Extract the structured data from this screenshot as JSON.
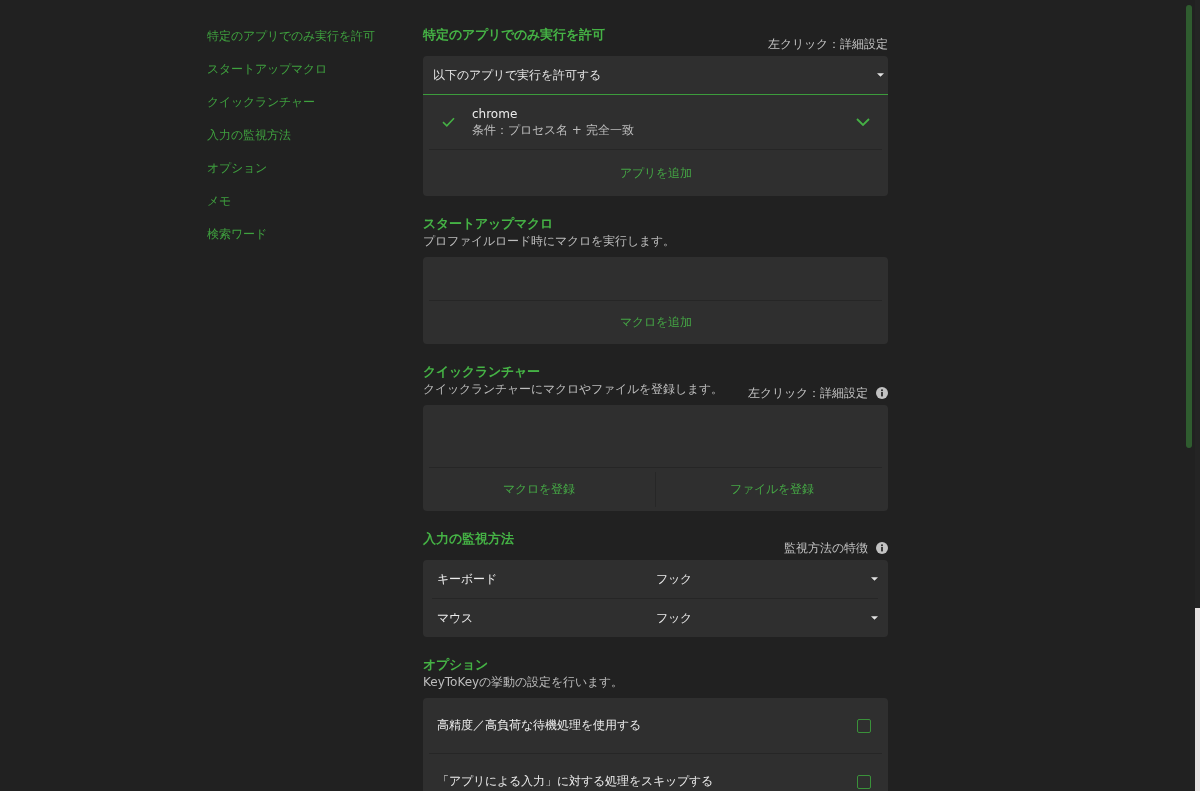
{
  "sidebar": {
    "items": [
      "特定のアプリでのみ実行を許可",
      "スタートアップマクロ",
      "クイックランチャー",
      "入力の監視方法",
      "オプション",
      "メモ",
      "検索ワード"
    ]
  },
  "sections": [
    {
      "kind": "app_filter",
      "title": "特定のアプリでのみ実行を許可",
      "hint": {
        "text": "左クリック：詳細設定"
      },
      "dropdown": {
        "value": "以下のアプリで実行を許可する"
      },
      "apps": [
        {
          "name": "chrome",
          "condition": "条件：プロセス名 + 完全一致",
          "enabled": true,
          "expanded": false
        }
      ],
      "buttons": [
        "アプリを追加"
      ]
    },
    {
      "kind": "macro_list",
      "title": "スタートアップマクロ",
      "description": "プロファイルロード時にマクロを実行します。",
      "buttons": [
        "マクロを追加"
      ]
    },
    {
      "kind": "launcher",
      "title": "クイックランチャー",
      "description": "クイックランチャーにマクロやファイルを登録します。",
      "hint": {
        "text": "左クリック：詳細設定",
        "info": true
      },
      "buttons": [
        "マクロを登録",
        "ファイルを登録"
      ]
    },
    {
      "kind": "selects",
      "title": "入力の監視方法",
      "hint": {
        "text": "監視方法の特徴",
        "info": true
      },
      "rows": [
        {
          "label": "キーボード",
          "value": "フック"
        },
        {
          "label": "マウス",
          "value": "フック"
        }
      ]
    },
    {
      "kind": "options",
      "title": "オプション",
      "description": "KeyToKeyの挙動の設定を行います。",
      "options": [
        {
          "label": "高精度／高負荷な待機処理を使用する",
          "checked": false
        },
        {
          "label": "「アプリによる入力」に対する処理をスキップする",
          "checked": false
        }
      ]
    }
  ]
}
